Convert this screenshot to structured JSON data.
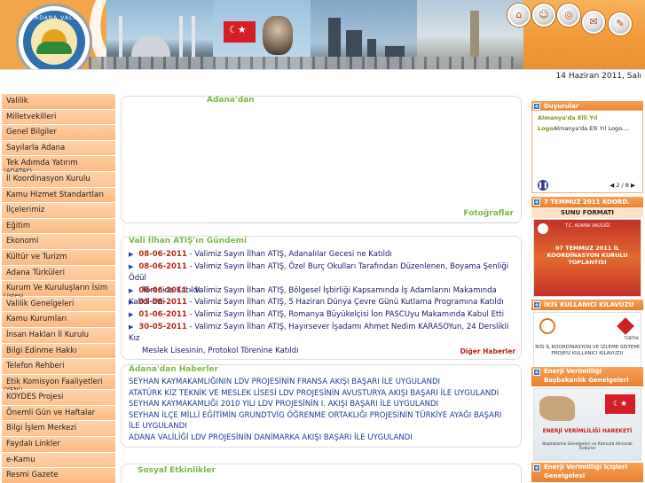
{
  "header": {
    "logo_text": "T.C. ADANA VALİLİĞİ",
    "date": "14 Haziran 2011, Salı",
    "icons": [
      "home-icon",
      "person-icon",
      "globe-icon",
      "mail-icon",
      "document-icon"
    ]
  },
  "menu": {
    "items": [
      {
        "label": "Valilik"
      },
      {
        "label": "Milletvekilleri"
      },
      {
        "label": "Genel Bilgiler"
      },
      {
        "label": "Sayılarla Adana"
      },
      {
        "label": "Tek Adımda Yatırım",
        "sub": "(ADATAY)"
      },
      {
        "label": "İl Koordinasyon Kurulu"
      },
      {
        "label": "Kamu Hizmet Standartları"
      },
      {
        "label": "İlçelerimiz"
      },
      {
        "label": "Eğitim"
      },
      {
        "label": "Ekonomi"
      },
      {
        "label": "Kültür ve Turizm"
      },
      {
        "label": "Adana Türküleri"
      },
      {
        "label": "Kurum Ve Kuruluşların İsim",
        "sub": "Listesi"
      },
      {
        "label": "Valilik Genelgeleri"
      },
      {
        "label": "Kamu Kurumları"
      },
      {
        "label": "İnsan Hakları İl Kurulu"
      },
      {
        "label": "Bilgi Edinme Hakkı"
      },
      {
        "label": "Telefon Rehberi"
      },
      {
        "label": "Etik Komisyon Faaliyetleri",
        "sub": "(YENİ)"
      },
      {
        "label": "KOYDES Projesi"
      },
      {
        "label": "Önemli Gün ve Haftalar"
      },
      {
        "label": "Bilgi İşlem Merkezi"
      },
      {
        "label": "Faydalı Linkler"
      },
      {
        "label": "e-Kamu"
      },
      {
        "label": "Resmi Gazete"
      }
    ]
  },
  "adana": {
    "title": "Adana'dan",
    "photos_link": "Fotoğraflar"
  },
  "gundem": {
    "title": "Vali İlhan ATIŞ'ın Gündemi",
    "items": [
      {
        "date": "08-06-2011",
        "text": " - Valimiz Sayın İlhan ATIŞ, Adanalılar Gecesi ne Katıldı"
      },
      {
        "date": "08-06-2011",
        "text": " - Valimiz Sayın İlhan ATIŞ, Özel Burç Okulları Tarafından Düzenlenen, Boyama Şenliği Ödül",
        "line2": "Törenine Katıldı"
      },
      {
        "date": "06-06-2011",
        "text": " - Valimiz Sayın İlhan ATIŞ, Bölgesel İşbirliği Kapsamında İş Adamlarını Makamında Kabul Etti"
      },
      {
        "date": "05-06-2011",
        "text": " - Valimiz Sayın İlhan ATIŞ, 5 Haziran Dünya Çevre Günü Kutlama Programına Katıldı"
      },
      {
        "date": "01-06-2011",
        "text": " - Valimiz Sayın İlhan ATIŞ, Romanya Büyükelçisi İon PASCUyu Makamında Kabul Etti"
      },
      {
        "date": "30-05-2011",
        "text": " - Valimiz Sayın İlhan ATIŞ, Hayırsever İşadamı Ahmet Nedim KARASOYun, 24 Derslikli Kız",
        "line2": "Meslek Lisesinin, Protokol Törenine Katıldı"
      }
    ],
    "more_link": "Diğer Haberler"
  },
  "haber": {
    "title": "Adana'dan Haberler",
    "items": [
      "SEYHAN KAYMAKAMLIĞININ LDV PROJESİNİN FRANSA AKIŞI BAŞARI İLE UYGULANDI",
      "ATATÜRK KIZ TEKNİK VE MESLEK LİSESİ LDV PROJESİNİN AVUSTURYA AKIŞI BAŞARI İLE UYGULANDI",
      "SEYHAN KAYMAKAMLIĞI 2010 YILI LDV PROJESİNİN I. AKIŞI BAŞARI İLE UYGULANDI",
      "SEYHAN İLÇE MİLLİ EĞİTİMİN GRUNDTVİG ÖĞRENME ORTAKLIĞI PROJESİNİN TÜRKİYE AYAĞI BAŞARI",
      "İLE UYGULANDI",
      "ADANA VALİLİĞİ LDV PROJESİNİN DANİMARKA AKIŞI BAŞARI İLE UYGULANDI"
    ]
  },
  "sosyal": {
    "title": "Sosyal Etkinlikler"
  },
  "right": {
    "duyurular_title": "Duyurular",
    "duy1_a": "Almanya'da",
    "duy1_b": " Elli Yıl",
    "duy2_a": "Logo",
    "duy2_b": "Almanya'da Elli Yıl Logo....",
    "pager": "2 / 8",
    "banner1_title": "7 TEMMUZ 2011 KOORD.",
    "banner1_sub": "SUNU FORMATI",
    "banner1_logo_text": "T.C. ADANA VALİLİĞİ",
    "banner1_text": "07 TEMMUZ 2011 İL KOORDİNASYON KURULU TOPLANTISI",
    "banner2_title": "İKİS KULLANICI KILAVUZU",
    "banner2_text": "İKİS İL KOORDİNASYON VE İZLEME SİSTEMİ PROJESİ KULLANICI KILAVUZU",
    "banner2_logo_text": "TÜBİTAK",
    "banner3_title": "Enerji Verimliliği Başbakanlık Genelgeleri",
    "banner3_text": "ENERJİ VERİMLİLİĞİ HAREKETİ",
    "banner3_sub": "Başbakanlık Genelgeleri ve Kamuda Alınacak Tedbirler",
    "banner4_title": "Enerji Verimliliği İçişleri Genelgelesi"
  }
}
